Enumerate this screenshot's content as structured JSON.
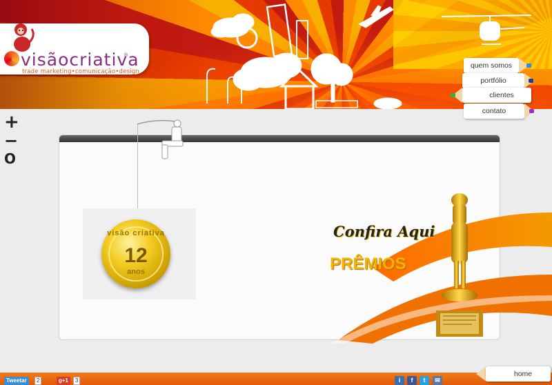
{
  "header": {
    "logo": {
      "wordmark": "visãocriativa",
      "registered_mark": "®",
      "tagline": "trade marketing•comunicação•design"
    }
  },
  "nav": [
    {
      "label": "quem somos",
      "lead_color": "#2a8fd8"
    },
    {
      "label": "portfólio",
      "lead_color": "#1a3aa8"
    },
    {
      "label": "clientes",
      "lead_color": "#2cb34a"
    },
    {
      "label": "contato",
      "lead_color": "#9b2bd6"
    }
  ],
  "zoom": {
    "in": "+",
    "out": "−",
    "reset": "O"
  },
  "main": {
    "medal": {
      "brand": "visão criativa",
      "number": "12",
      "unit": "anos"
    },
    "promo": {
      "headline": "Confira Aqui",
      "title": "PRÊMIOS"
    }
  },
  "footer": {
    "home_label": "home",
    "tweet_label": "Tweetar",
    "tweet_count": "2",
    "gplus_label": "g+1",
    "gplus_count": "3",
    "icons": [
      "info-icon",
      "facebook-icon",
      "twitter-icon",
      "email-icon"
    ]
  },
  "colors": {
    "accent_orange": "#f07c1c",
    "brand_purple": "#8a2a82",
    "gold": "#f3b300"
  }
}
